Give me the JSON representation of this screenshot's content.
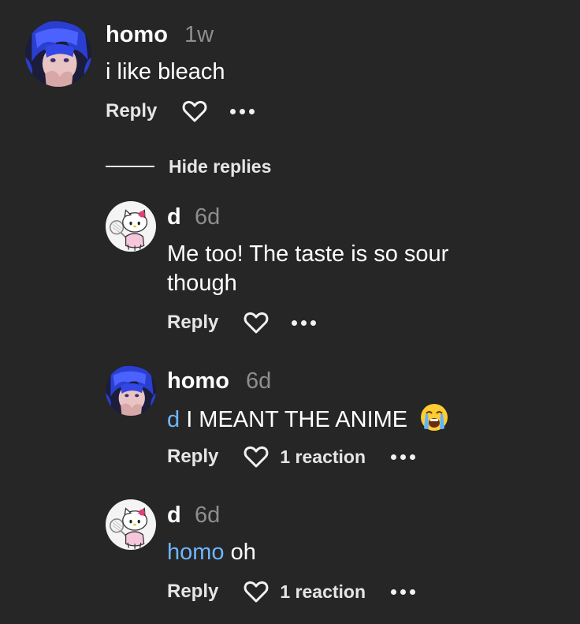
{
  "comments": [
    {
      "username": "homo",
      "time": "1w",
      "text": "i like bleach",
      "avatar": "blue-hair-anime-avatar",
      "reply_label": "Reply"
    }
  ],
  "hide_replies_label": "Hide replies",
  "replies": [
    {
      "username": "d",
      "time": "6d",
      "text_line1": "Me too! The taste is so sour",
      "text_line2": "though",
      "avatar": "hello-kitty-avatar",
      "reply_label": "Reply"
    },
    {
      "username": "homo",
      "time": "6d",
      "mention": "d",
      "text": " I MEANT THE ANIME",
      "emoji": "loudly-crying-face",
      "avatar": "blue-hair-anime-avatar",
      "reply_label": "Reply",
      "reactions": "1 reaction"
    },
    {
      "username": "d",
      "time": "6d",
      "mention": "homo",
      "text": " oh",
      "avatar": "hello-kitty-avatar",
      "reply_label": "Reply",
      "reactions": "1 reaction"
    }
  ],
  "colors": {
    "background": "#262626",
    "mention": "#6fb6ff",
    "timestamp": "#8e8e8e"
  }
}
